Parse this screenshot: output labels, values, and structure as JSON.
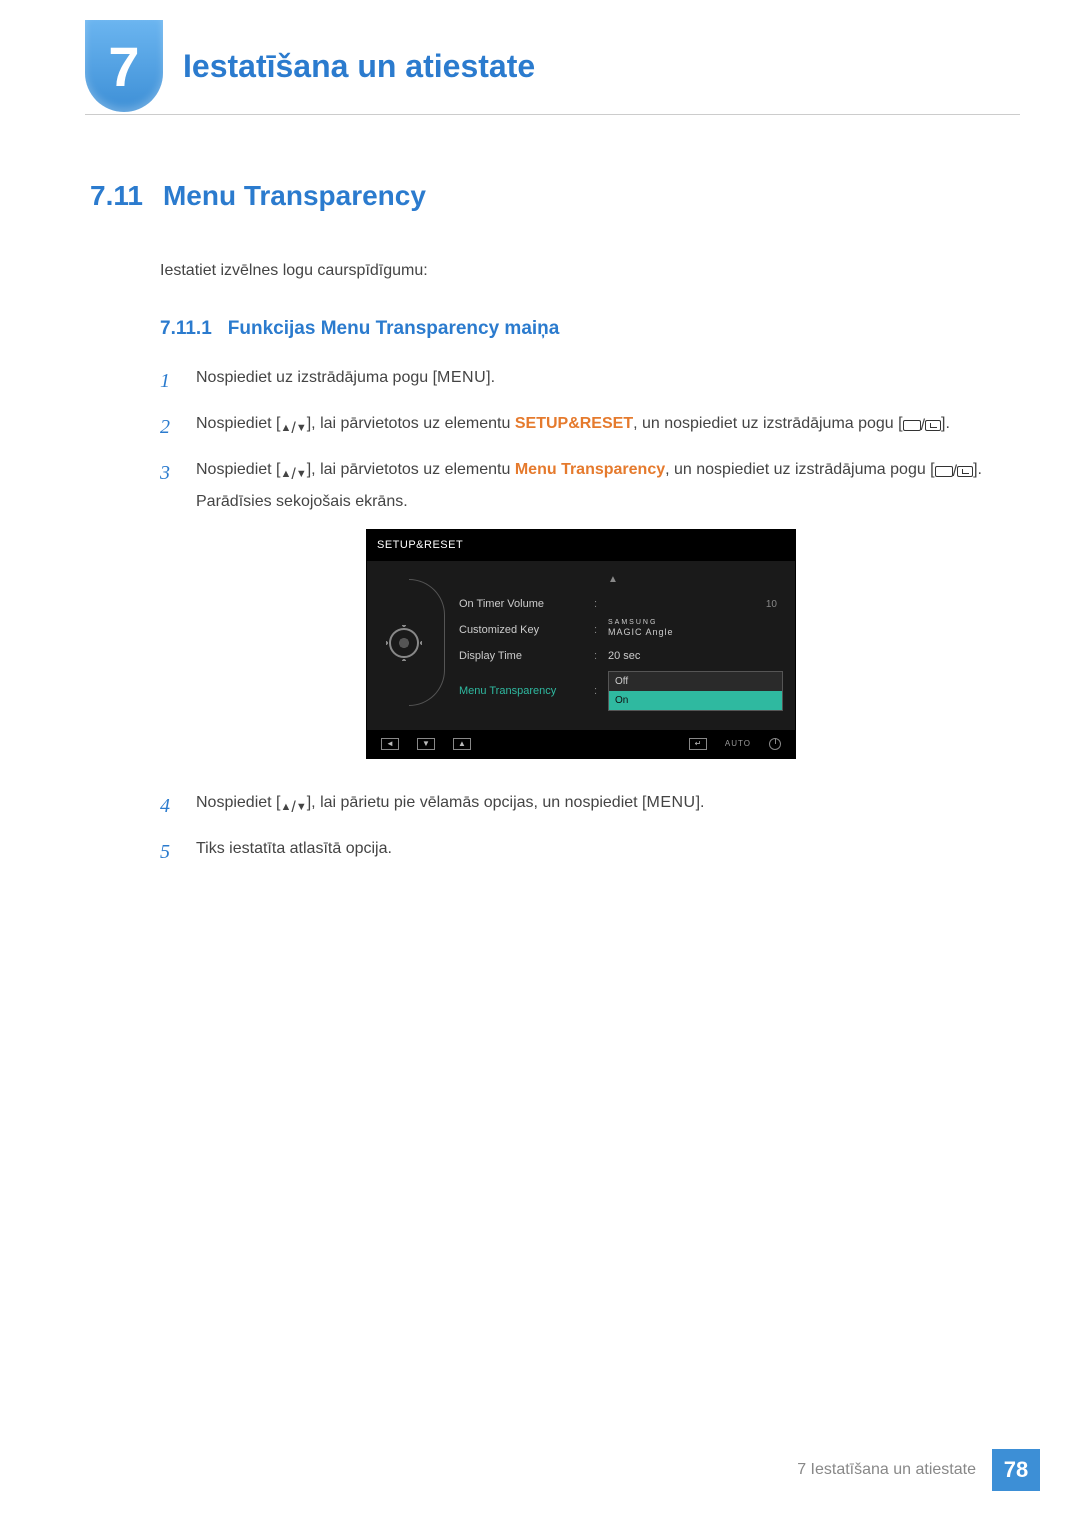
{
  "header": {
    "chapter_number": "7",
    "chapter_title": "Iestatīšana un atiestate"
  },
  "section": {
    "number": "7.11",
    "title": "Menu Transparency",
    "intro": "Iestatiet izvēlnes logu caurspīdīgumu:"
  },
  "subsection": {
    "number": "7.11.1",
    "title": "Funkcijas Menu Transparency maiņa"
  },
  "steps": {
    "s1": {
      "num": "1",
      "t1": "Nospiediet uz izstrādājuma pogu [",
      "menu": "MENU",
      "t2": "]."
    },
    "s2": {
      "num": "2",
      "t1": "Nospiediet [",
      "t2": "], lai pārvietotos uz elementu ",
      "bold": "SETUP&RESET",
      "t3": ", un nospiediet uz izstrādājuma pogu [",
      "t4": "]."
    },
    "s3": {
      "num": "3",
      "t1": "Nospiediet [",
      "t2": "], lai pārvietotos uz elementu ",
      "bold": "Menu Transparency",
      "t3": ", un nospiediet uz izstrādājuma pogu [",
      "t4": "]. Parādīsies sekojošais ekrāns."
    },
    "s4": {
      "num": "4",
      "t1": "Nospiediet [",
      "t2": "], lai pārietu pie vēlamās opcijas, un nospiediet [",
      "menu": "MENU",
      "t3": "]."
    },
    "s5": {
      "num": "5",
      "t1": "Tiks iestatīta atlasītā opcija."
    }
  },
  "osd": {
    "title": "SETUP&RESET",
    "rows": {
      "r1": {
        "label": "On Timer  Volume",
        "value_right": "10"
      },
      "r2": {
        "label": "Customized Key",
        "value_brand_top": "SAMSUNG",
        "value_brand": "MAGIC",
        "value_suffix": " Angle"
      },
      "r3": {
        "label": "Display Time",
        "value": "20 sec"
      },
      "r4": {
        "label": "Menu Transparency",
        "opt_off": "Off",
        "opt_on": "On"
      }
    },
    "footer_auto": "AUTO"
  },
  "footer": {
    "text": "7 Iestatīšana un atiestate",
    "page": "78"
  }
}
